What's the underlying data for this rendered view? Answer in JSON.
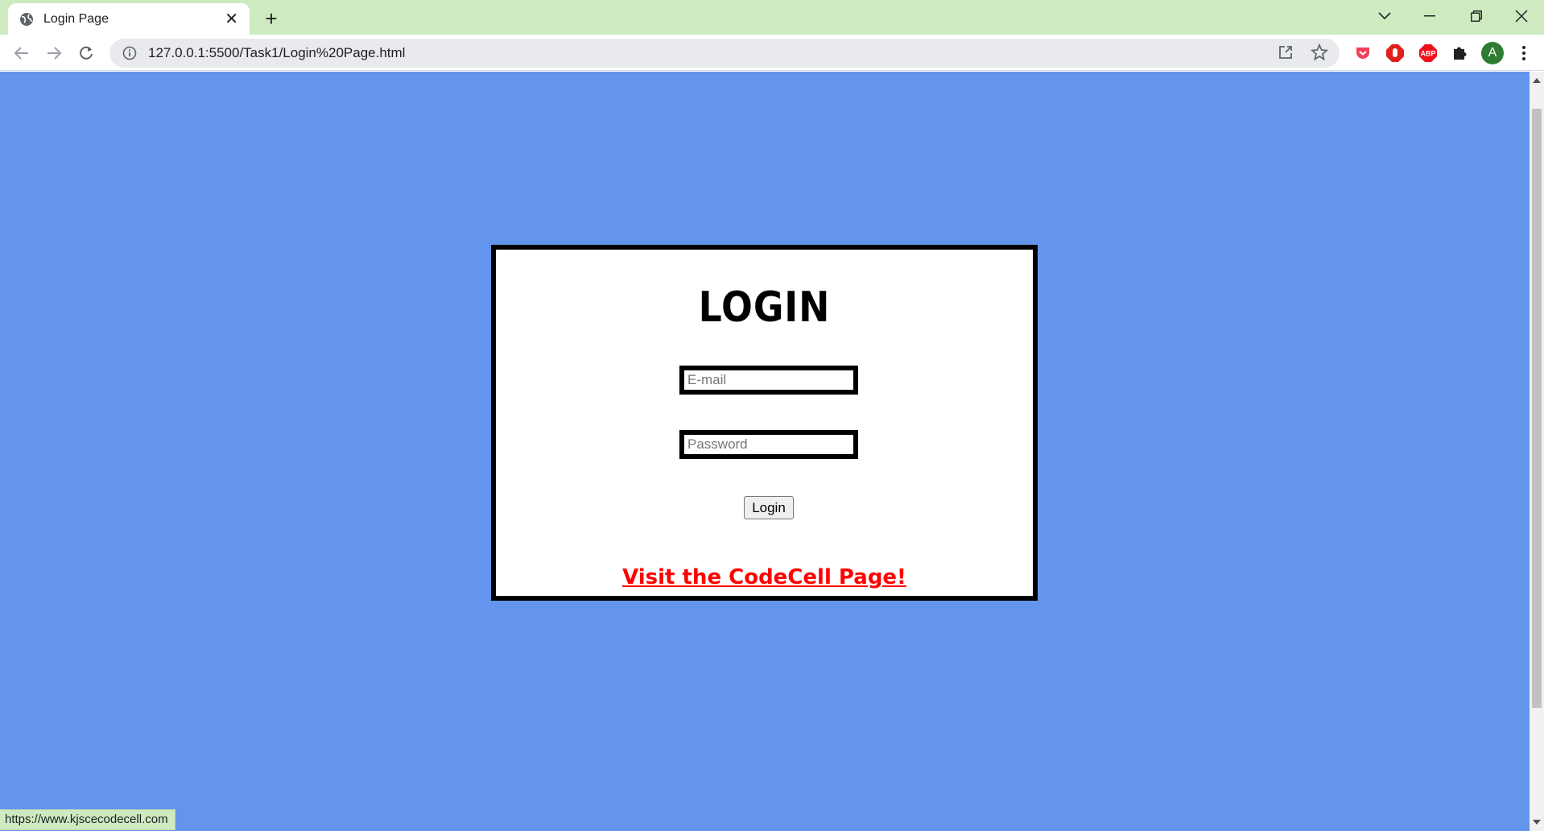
{
  "browser": {
    "tab": {
      "title": "Login Page"
    },
    "address_bar": {
      "url": "127.0.0.1:5500/Task1/Login%20Page.html"
    },
    "profile_initial": "A",
    "extension_badge": "ABP",
    "status_bar_url": "https://www.kjscecodecell.com"
  },
  "login": {
    "heading": "LOGIN",
    "email": {
      "placeholder": "E-mail",
      "value": ""
    },
    "password": {
      "placeholder": "Password",
      "value": ""
    },
    "submit_label": "Login",
    "codecell_link_text": "Visit the CodeCell Page!"
  },
  "colors": {
    "page_background": "#6495ed",
    "card_background": "#ffffff",
    "card_border": "#000000",
    "link": "#ff0000",
    "tab_strip": "#cdeac0"
  },
  "icons": {
    "tab": "globe-icon",
    "back": "back-arrow-icon",
    "forward": "forward-arrow-icon",
    "reload": "reload-icon",
    "site_info": "info-icon",
    "share": "share-icon",
    "bookmark": "star-icon",
    "extensions": [
      "pocket-icon",
      "stop-icon",
      "adblock-icon",
      "puzzle-icon"
    ],
    "menu": "kebab-menu-icon"
  }
}
